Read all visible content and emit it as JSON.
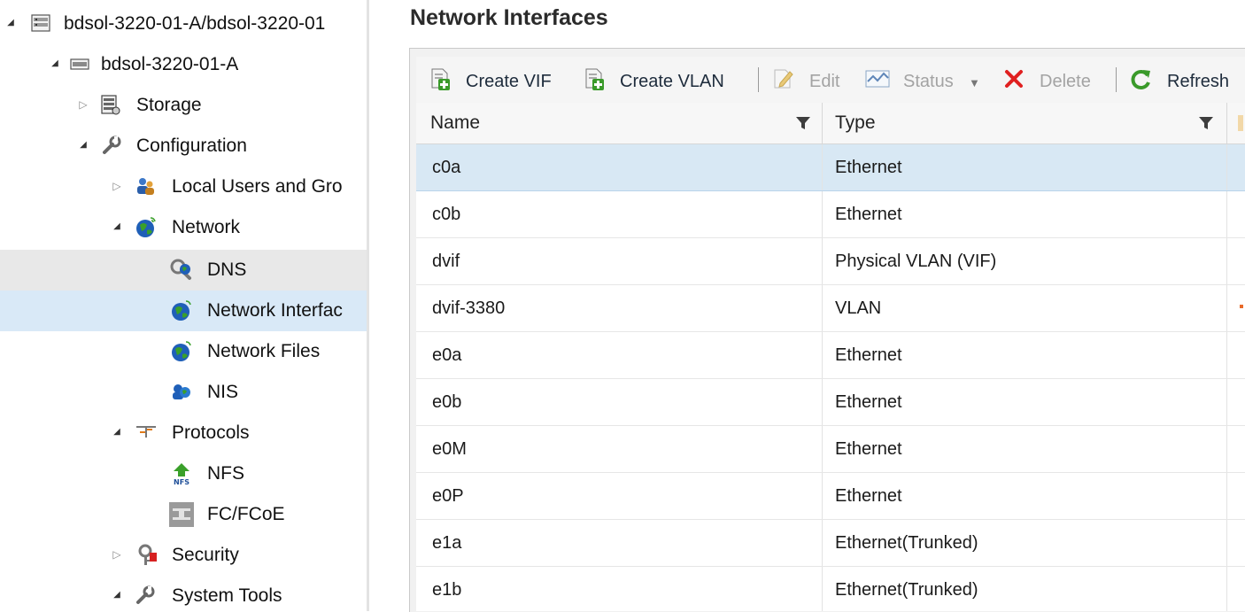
{
  "tree": {
    "items": [
      {
        "label": "bdsol-3220-01-A/bdsol-3220-01",
        "icon": "cluster-icon"
      },
      {
        "label": "bdsol-3220-01-A",
        "icon": "node-icon"
      },
      {
        "label": "Storage",
        "icon": "storage-icon"
      },
      {
        "label": "Configuration",
        "icon": "wrench-icon"
      },
      {
        "label": "Local Users and Gro",
        "icon": "users-icon"
      },
      {
        "label": "Network",
        "icon": "globe-icon"
      },
      {
        "label": "DNS",
        "icon": "dns-icon"
      },
      {
        "label": "Network Interfac",
        "icon": "globe-icon"
      },
      {
        "label": "Network Files",
        "icon": "globe-icon"
      },
      {
        "label": "NIS",
        "icon": "nis-icon"
      },
      {
        "label": "Protocols",
        "icon": "protocols-icon"
      },
      {
        "label": "NFS",
        "icon": "nfs-icon"
      },
      {
        "label": "FC/FCoE",
        "icon": "fc-icon"
      },
      {
        "label": "Security",
        "icon": "key-icon"
      },
      {
        "label": "System Tools",
        "icon": "wrench-icon"
      }
    ],
    "selected": "Network Interfac",
    "hovered": "DNS"
  },
  "main": {
    "title": "Network Interfaces",
    "toolbar": {
      "create_vif": "Create VIF",
      "create_vlan": "Create VLAN",
      "edit": "Edit",
      "status": "Status",
      "delete": "Delete",
      "refresh": "Refresh"
    },
    "grid": {
      "columns": [
        "Name",
        "Type"
      ],
      "rows": [
        {
          "name": "c0a",
          "type": "Ethernet"
        },
        {
          "name": "c0b",
          "type": "Ethernet"
        },
        {
          "name": "dvif",
          "type": "Physical VLAN (VIF)"
        },
        {
          "name": "dvif-3380",
          "type": "VLAN"
        },
        {
          "name": "e0a",
          "type": "Ethernet"
        },
        {
          "name": "e0b",
          "type": "Ethernet"
        },
        {
          "name": "e0M",
          "type": "Ethernet"
        },
        {
          "name": "e0P",
          "type": "Ethernet"
        },
        {
          "name": "e1a",
          "type": "Ethernet(Trunked)"
        },
        {
          "name": "e1b",
          "type": "Ethernet(Trunked)"
        }
      ],
      "selected_row": "c0a"
    }
  },
  "colors": {
    "selection": "#d9e9f7",
    "accent_green": "#3a9a2a",
    "delete_red": "#e02020",
    "globe_blue": "#1f5fb8"
  }
}
